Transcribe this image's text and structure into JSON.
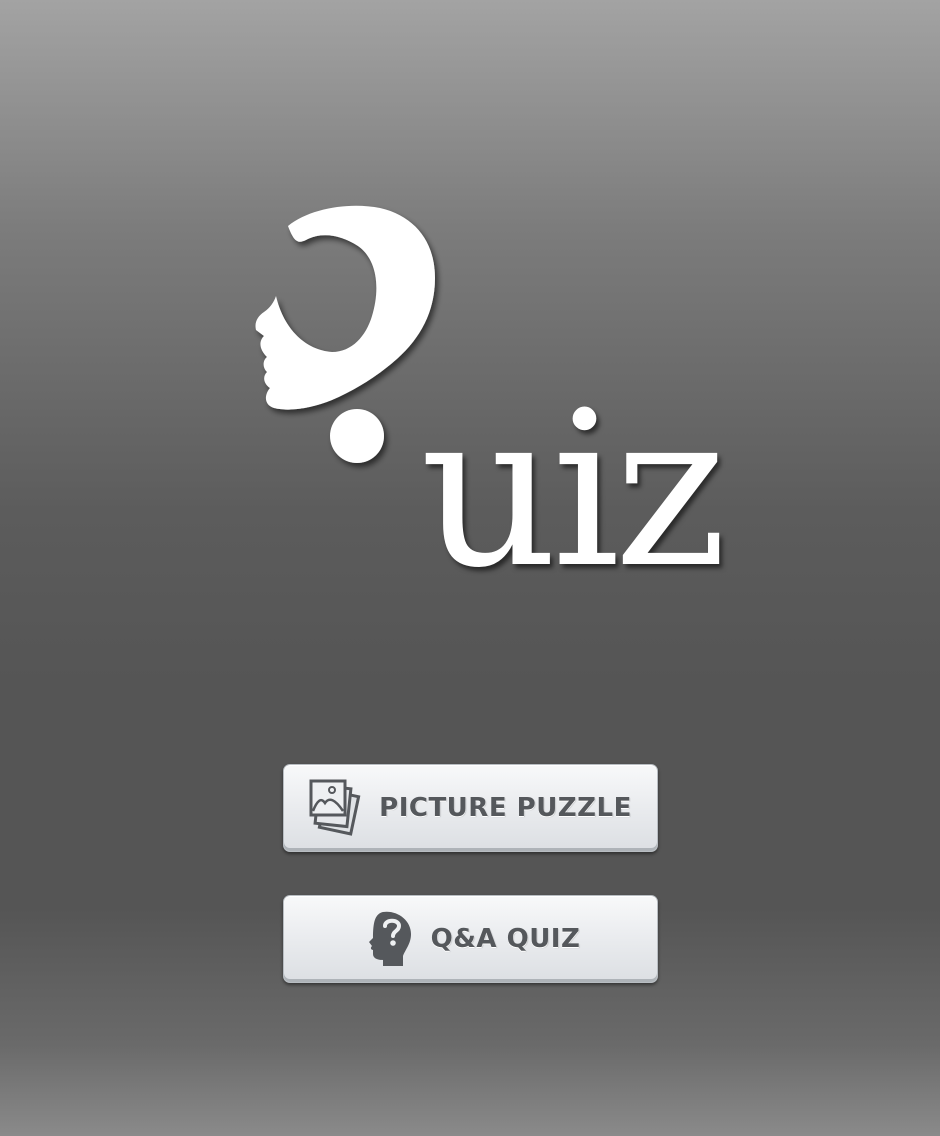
{
  "logo": {
    "text": "uiz"
  },
  "menu": {
    "picture_puzzle_label": "PICTURE PUZZLE",
    "qa_quiz_label": "Q&A QUIZ"
  },
  "icons": {
    "logo_mark": "question-mark-face-icon",
    "picture_puzzle": "photo-stack-icon",
    "qa_quiz": "head-question-icon"
  },
  "colors": {
    "button_text": "#55585c",
    "logo": "#ffffff",
    "icon": "#55585c"
  }
}
